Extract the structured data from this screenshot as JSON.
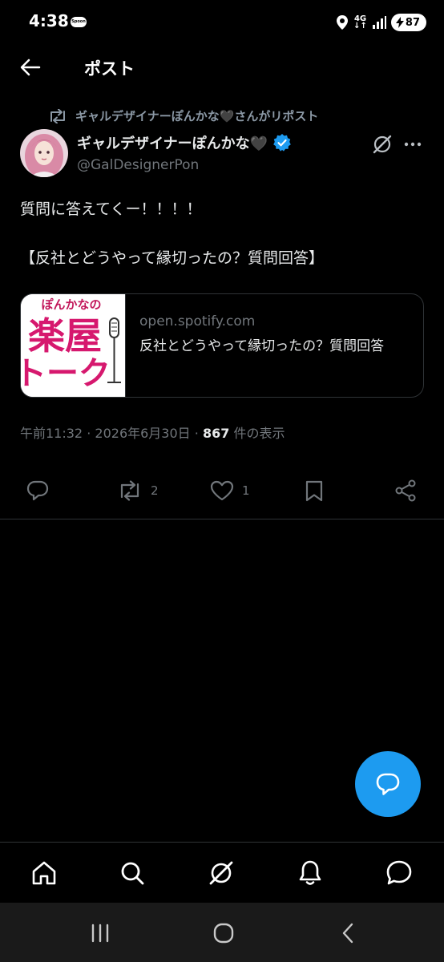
{
  "status_bar": {
    "time": "4:38",
    "spoon_label": "Spoon",
    "network": "4G",
    "battery": "87"
  },
  "header": {
    "title": "ポスト",
    "back_icon": "arrow-left-icon"
  },
  "post": {
    "repost_text": "ギャルデザイナーぽんかな🖤さんがリポスト",
    "display_name": "ギャルデザイナーぽんかな🖤",
    "verified": true,
    "handle": "@GalDesignerPon",
    "text_line1": "質問に答えてくー！！！！",
    "text_line2": "【反社とどうやって縁切ったの？質問回答】",
    "card": {
      "domain": "open.spotify.com",
      "title": "反社とどうやって縁切ったの？質問回答",
      "thumb_line1": "ぽんかなの",
      "thumb_line2": "楽屋",
      "thumb_line3": "トーク"
    },
    "meta": {
      "time": "午前11:32",
      "separator": "·",
      "date": "2026年6月30日",
      "views_count": "867",
      "views_label": " 件の表示"
    },
    "actions": {
      "reply_count": "",
      "repost_count": "2",
      "like_count": "1"
    }
  },
  "colors": {
    "background": "#000000",
    "accent": "#1d9bf0",
    "text_secondary": "#71767b",
    "thumb_pink": "#d6186e"
  },
  "bottom_nav": [
    "home-icon",
    "search-icon",
    "grok-icon",
    "notifications-icon",
    "messages-icon"
  ]
}
